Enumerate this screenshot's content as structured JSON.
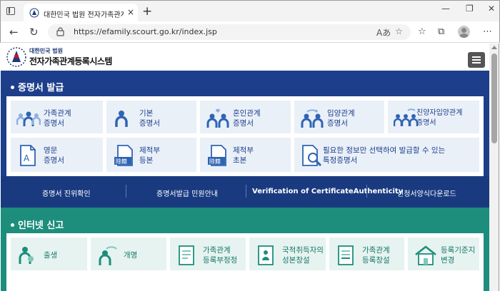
{
  "browser": {
    "tab_title": "대한민국 법원 전자가족관계등록",
    "tab_close": "×",
    "new_tab": "+",
    "url": "https://efamily.scourt.go.kr/index.jsp",
    "window_controls": [
      "—",
      "❐",
      "✕"
    ]
  },
  "header": {
    "logo_sub": "대한민국 법원",
    "logo_main": "전자가족관계등록시스템"
  },
  "certificate": {
    "title": "증명서 발급",
    "items": [
      {
        "label": "가족관계\n증명서",
        "icon": "family-icon"
      },
      {
        "label": "기본\n증명서",
        "icon": "person-icon"
      },
      {
        "label": "혼인관계\n증명서",
        "icon": "couple-heart-icon"
      },
      {
        "label": "입양관계\n증명서",
        "icon": "adoption-icon"
      },
      {
        "label": "친양자입양관계\n증명서",
        "icon": "family-adoption-icon"
      },
      {
        "label": "영문\n증명서",
        "icon": "english-document-icon"
      },
      {
        "label": "제적부\n등본",
        "icon": "removed-register-icon"
      },
      {
        "label": "제적부\n초본",
        "icon": "removed-register-icon"
      },
      {
        "label": "필요한 정보만 선택하여 발급할 수 있는\n특정증명서",
        "icon": "search-document-icon"
      }
    ],
    "stamp_text": "除籍",
    "doc_letter": "A",
    "quick_links": [
      "증명서 진위확인",
      "증명서발급 민원안내",
      "Verification of CertificateAuthenticity",
      "신청서양식다운로드"
    ]
  },
  "report": {
    "title": "인터넷 신고",
    "items": [
      {
        "label": "출생",
        "icon": "birth-icon"
      },
      {
        "label": "개명",
        "icon": "rename-icon"
      },
      {
        "label": "가족관계\n등록부정정",
        "icon": "correction-form-icon"
      },
      {
        "label": "국적취득자의\n성본창설",
        "icon": "nationality-form-icon"
      },
      {
        "label": "가족관계\n등록창설",
        "icon": "registration-form-icon"
      },
      {
        "label": "등록기준지\n변경",
        "icon": "house-icon"
      }
    ]
  },
  "colors": {
    "certificate_bg": "#1d3f8b",
    "report_bg": "#1d8d7c",
    "card_bg": "#eaf0f8",
    "icon_blue": "#2f64b3",
    "icon_light": "#8fb0de"
  }
}
